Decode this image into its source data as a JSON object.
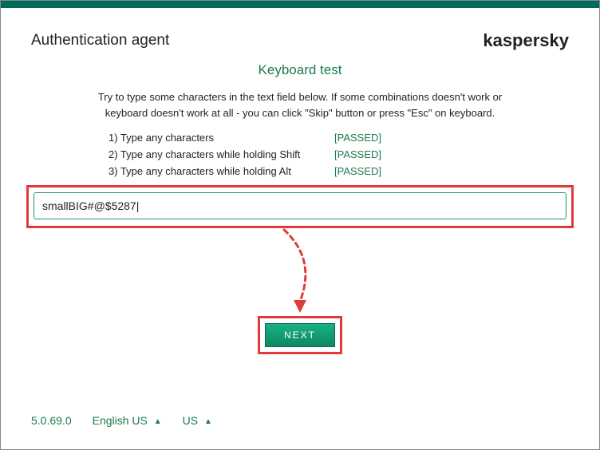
{
  "header": {
    "app_title": "Authentication agent",
    "brand": "kaspersky"
  },
  "section_title": "Keyboard test",
  "instructions": "Try to type some characters in the text field below. If some combinations doesn't work or keyboard doesn't work at all - you can click \"Skip\" button or press \"Esc\" on keyboard.",
  "steps": [
    {
      "label": "1) Type any characters",
      "status": "[PASSED]"
    },
    {
      "label": "2) Type any characters while holding Shift",
      "status": "[PASSED]"
    },
    {
      "label": "3) Type any characters while holding Alt",
      "status": "[PASSED]"
    }
  ],
  "input": {
    "value": "smallBIG#@$5287|"
  },
  "next_button": {
    "label": "NEXT"
  },
  "footer": {
    "version": "5.0.69.0",
    "language": "English US",
    "layout": "US",
    "up_glyph": "▲"
  },
  "colors": {
    "brand_green": "#006d5b",
    "accent_green": "#1d7a4b",
    "highlight_red": "#e03a3a"
  }
}
